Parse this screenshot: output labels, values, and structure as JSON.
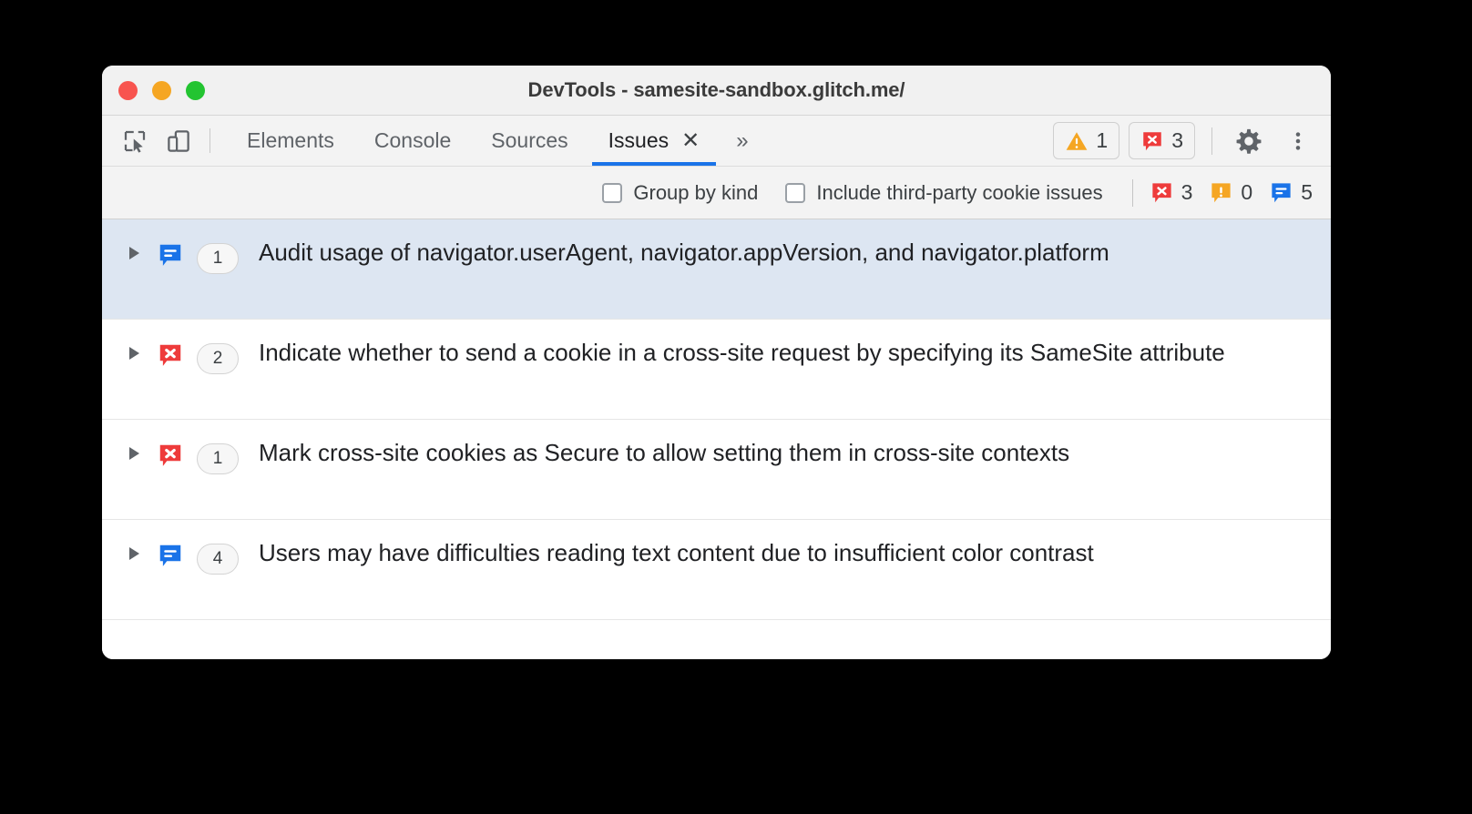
{
  "window": {
    "title": "DevTools - samesite-sandbox.glitch.me/",
    "traffic_lights": {
      "close": "close-red",
      "minimize": "minimize-yellow",
      "maximize": "maximize-green"
    },
    "colors": {
      "accent": "#1a73e8",
      "error": "#ee3b3b",
      "warning": "#f5a623",
      "info": "#1a73e8",
      "selected_row": "#dde6f2",
      "chrome": "#f3f3f3"
    }
  },
  "toolbar": {
    "inspect_icon": "inspect-element-icon",
    "device_icon": "device-toolbar-icon",
    "tabs": [
      {
        "label": "Elements",
        "active": false
      },
      {
        "label": "Console",
        "active": false
      },
      {
        "label": "Sources",
        "active": false
      },
      {
        "label": "Issues",
        "active": true
      }
    ],
    "close_tab": "✕",
    "overflow": "»",
    "warning_badge": {
      "icon": "warning-triangle-icon",
      "count": "1"
    },
    "error_badge": {
      "icon": "error-bubble-icon",
      "count": "3"
    },
    "settings_icon": "gear-icon",
    "more_icon": "kebab-menu-icon"
  },
  "filter_bar": {
    "group_by_kind": {
      "label": "Group by kind",
      "checked": false
    },
    "include_third_party": {
      "label": "Include third-party cookie issues",
      "checked": false
    },
    "counts": [
      {
        "kind": "error",
        "icon": "error-bubble-icon",
        "value": "3"
      },
      {
        "kind": "warning",
        "icon": "warning-bubble-icon",
        "value": "0"
      },
      {
        "kind": "info",
        "icon": "info-bubble-icon",
        "value": "5"
      }
    ]
  },
  "issues": [
    {
      "kind": "info",
      "count": "1",
      "title": "Audit usage of navigator.userAgent, navigator.appVersion, and navigator.platform",
      "selected": true
    },
    {
      "kind": "error",
      "count": "2",
      "title": "Indicate whether to send a cookie in a cross-site request by specifying its SameSite attribute",
      "selected": false
    },
    {
      "kind": "error",
      "count": "1",
      "title": "Mark cross-site cookies as Secure to allow setting them in cross-site contexts",
      "selected": false
    },
    {
      "kind": "info",
      "count": "4",
      "title": "Users may have difficulties reading text content due to insufficient color contrast",
      "selected": false
    }
  ]
}
